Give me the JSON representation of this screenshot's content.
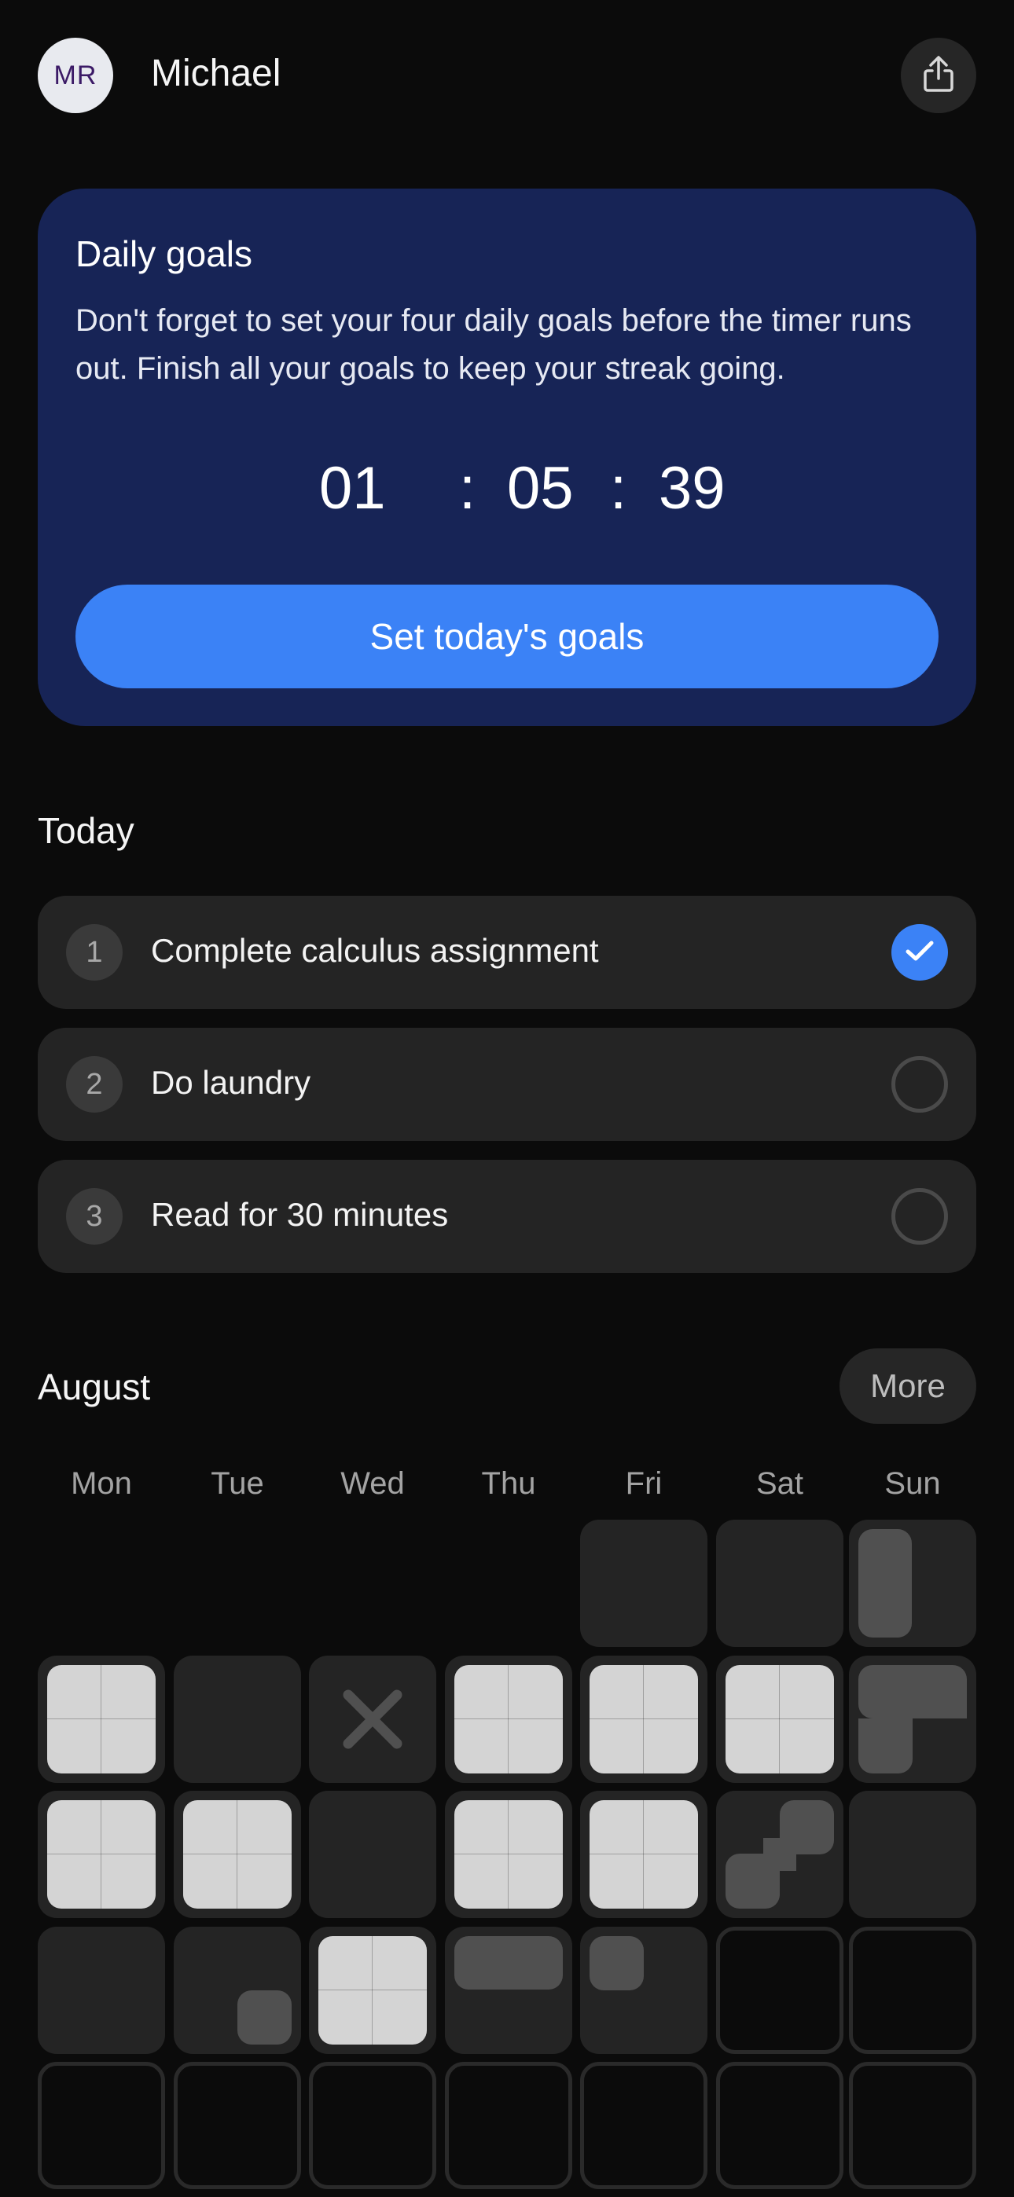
{
  "header": {
    "avatar_initials": "MR",
    "user_name": "Michael",
    "share_icon": "share-icon"
  },
  "goals_card": {
    "title": "Daily goals",
    "description": "Don't forget to set your four daily goals before the timer runs out. Finish all your goals to keep your streak going.",
    "timer": {
      "hours": "01",
      "minutes": "05",
      "seconds": "39",
      "separator": ":"
    },
    "button_label": "Set today's goals"
  },
  "today": {
    "title": "Today",
    "tasks": [
      {
        "number": "1",
        "label": "Complete calculus assignment",
        "done": true
      },
      {
        "number": "2",
        "label": "Do laundry",
        "done": false
      },
      {
        "number": "3",
        "label": "Read for 30 minutes",
        "done": false
      }
    ]
  },
  "calendar": {
    "month": "August",
    "more_label": "More",
    "weekdays": [
      "Mon",
      "Tue",
      "Wed",
      "Thu",
      "Fri",
      "Sat",
      "Sun"
    ],
    "rows": [
      [
        null,
        null,
        null,
        null,
        "none",
        "none",
        "p-left-lower-to-mid"
      ],
      [
        "full",
        "none",
        "missed",
        "full",
        "full",
        "full",
        "p-L-shape"
      ],
      [
        "full",
        "full",
        "none",
        "full",
        "full",
        "p-diag",
        "none"
      ],
      [
        "none",
        "p-small-br",
        "full",
        "p-top-bar",
        "p-small-tl",
        "future",
        "future"
      ],
      [
        "future",
        "future",
        "future",
        "future",
        "future",
        "future",
        "future"
      ]
    ],
    "colors": {
      "complete": "#d4d4d4",
      "partial": "#505050",
      "missed": "#505050"
    }
  },
  "colors": {
    "accent": "#3b82f6",
    "card": "#172456",
    "background": "#0b0b0b"
  }
}
